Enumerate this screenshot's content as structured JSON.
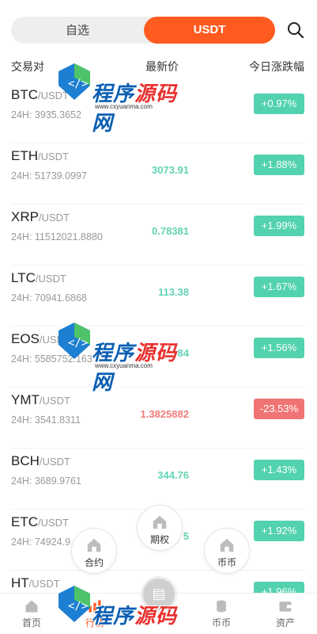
{
  "tabs": {
    "favorites": "自选",
    "usdt": "USDT"
  },
  "columns": {
    "pair": "交易对",
    "price": "最新价",
    "change": "今日涨跌幅"
  },
  "rows": [
    {
      "base": "BTC",
      "quote": "/USDT",
      "volume": "24H: 3935.3652",
      "price": "",
      "change": "+0.97%",
      "direction": "up"
    },
    {
      "base": "ETH",
      "quote": "/USDT",
      "volume": "24H: 51739.0997",
      "price": "3073.91",
      "change": "+1.88%",
      "direction": "up"
    },
    {
      "base": "XRP",
      "quote": "/USDT",
      "volume": "24H: 11512021.8880",
      "price": "0.78381",
      "change": "+1.99%",
      "direction": "up"
    },
    {
      "base": "LTC",
      "quote": "/USDT",
      "volume": "24H: 70941.6868",
      "price": "113.38",
      "change": "+1.67%",
      "direction": "up"
    },
    {
      "base": "EOS",
      "quote": "/USDT",
      "volume": "24H: 5585752.163",
      "price": "2.584",
      "change": "+1.56%",
      "direction": "up"
    },
    {
      "base": "YMT",
      "quote": "/USDT",
      "volume": "24H: 3541.8311",
      "price": "1.3825882",
      "change": "-23.53%",
      "direction": "down"
    },
    {
      "base": "BCH",
      "quote": "/USDT",
      "volume": "24H: 3689.9761",
      "price": "344.76",
      "change": "+1.43%",
      "direction": "up"
    },
    {
      "base": "ETC",
      "quote": "/USDT",
      "volume": "24H: 74924.9",
      "price": "5",
      "change": "+1.92%",
      "direction": "up"
    },
    {
      "base": "HT",
      "quote": "/USDT",
      "volume": "",
      "price": "3",
      "change": "+1.96%",
      "direction": "up"
    }
  ],
  "floating_menu": {
    "contract": "合约",
    "options": "期权",
    "coin": "币币"
  },
  "bottom_nav": {
    "home": "首页",
    "market": "行情",
    "coin": "币币",
    "assets": "资产"
  },
  "watermark": {
    "text": "程序源码网",
    "url": "www.cxyuanma.com"
  },
  "colors": {
    "accent": "#ff5a1f",
    "up": "#52d2ae",
    "down": "#f07474"
  },
  "icons": [
    "search-icon",
    "home-icon",
    "chart-icon",
    "coins-icon",
    "wallet-icon",
    "house-icon",
    "menu-toggle-icon"
  ]
}
